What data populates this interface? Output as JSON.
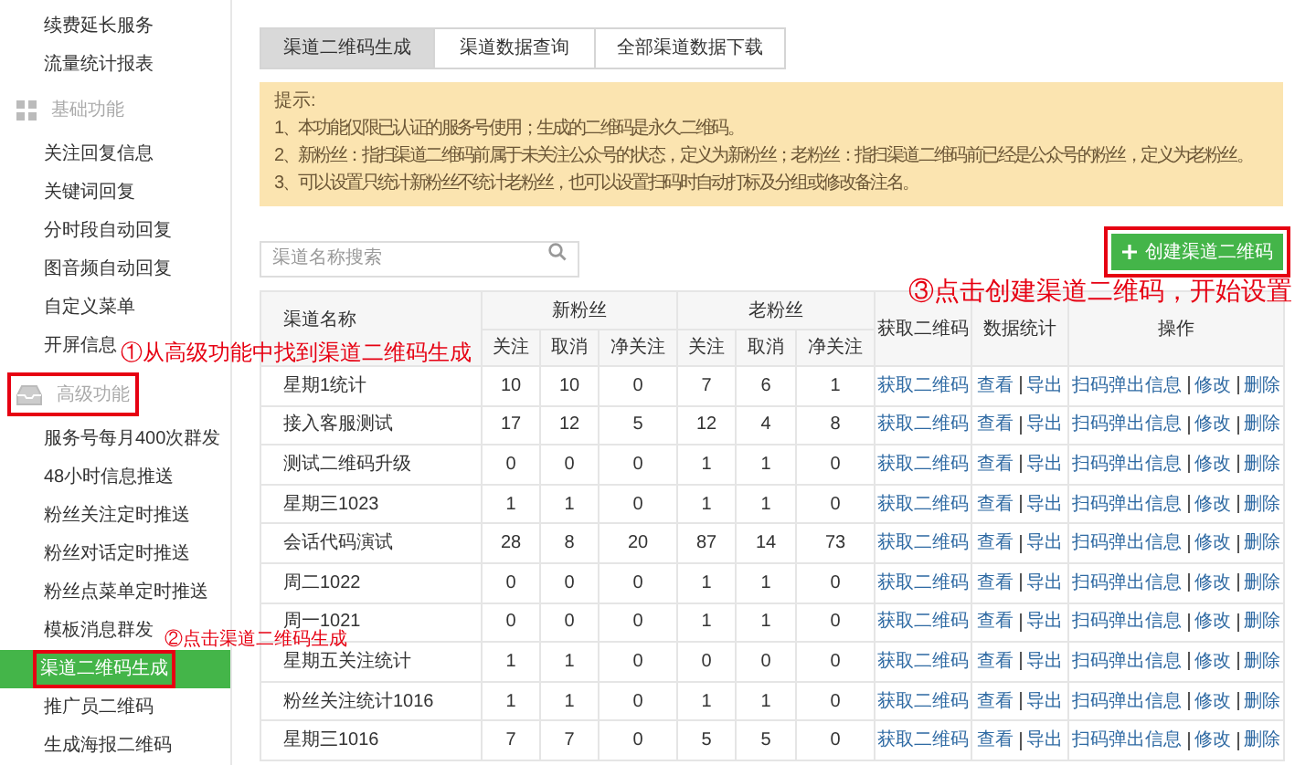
{
  "sidebar": {
    "items": [
      {
        "kind": "item",
        "label": "续费延长服务",
        "selected": false,
        "highlighted": false
      },
      {
        "kind": "item",
        "label": "流量统计报表",
        "selected": false,
        "highlighted": false
      },
      {
        "kind": "section",
        "label": "基础功能",
        "highlighted": false
      },
      {
        "kind": "item",
        "label": "关注回复信息",
        "selected": false,
        "highlighted": false
      },
      {
        "kind": "item",
        "label": "关键词回复",
        "selected": false,
        "highlighted": false
      },
      {
        "kind": "item",
        "label": "分时段自动回复",
        "selected": false,
        "highlighted": false
      },
      {
        "kind": "item",
        "label": "图音频自动回复",
        "selected": false,
        "highlighted": false
      },
      {
        "kind": "item",
        "label": "自定义菜单",
        "selected": false,
        "highlighted": false
      },
      {
        "kind": "item",
        "label": "开屏信息",
        "selected": false,
        "highlighted": false
      },
      {
        "kind": "section",
        "label": "高级功能",
        "highlighted": true
      },
      {
        "kind": "item",
        "label": "服务号每月400次群发",
        "selected": false,
        "highlighted": false
      },
      {
        "kind": "item",
        "label": "48小时信息推送",
        "selected": false,
        "highlighted": false
      },
      {
        "kind": "item",
        "label": "粉丝关注定时推送",
        "selected": false,
        "highlighted": false
      },
      {
        "kind": "item",
        "label": "粉丝对话定时推送",
        "selected": false,
        "highlighted": false
      },
      {
        "kind": "item",
        "label": "粉丝点菜单定时推送",
        "selected": false,
        "highlighted": false
      },
      {
        "kind": "item",
        "label": "模板消息群发",
        "selected": false,
        "highlighted": false
      },
      {
        "kind": "item",
        "label": "渠道二维码生成",
        "selected": true,
        "highlighted": true
      },
      {
        "kind": "item",
        "label": "推广员二维码",
        "selected": false,
        "highlighted": false
      },
      {
        "kind": "item",
        "label": "生成海报二维码",
        "selected": false,
        "highlighted": false
      }
    ]
  },
  "tabs": [
    {
      "label": "渠道二维码生成",
      "selected": true
    },
    {
      "label": "渠道数据查询",
      "selected": false
    },
    {
      "label": "全部渠道数据下载",
      "selected": false
    }
  ],
  "notice": {
    "title": "提示:",
    "lines": [
      "1、本功能仅限已认证的服务号使用；生成的二维码是永久二维码。",
      "2、新粉丝：指扫渠道二维码前属于未关注公众号的状态，定义为新粉丝；老粉丝：指扫渠道二维码前已经是公众号的粉丝，定义为老粉丝。",
      "3、可以设置只统计新粉丝不统计老粉丝，也可以设置扫码时自动打标及分组或修改备注名。"
    ]
  },
  "search": {
    "placeholder": "渠道名称搜索"
  },
  "create_button": {
    "label": "创建渠道二维码",
    "highlighted": true
  },
  "table": {
    "columns": [
      {
        "label": "渠道名称"
      },
      {
        "label": "新粉丝",
        "subcolumns": [
          "关注",
          "取消",
          "净关注"
        ]
      },
      {
        "label": "老粉丝",
        "subcolumns": [
          "关注",
          "取消",
          "净关注"
        ]
      },
      {
        "label": "获取二维码"
      },
      {
        "label": "数据统计"
      },
      {
        "label": "操作"
      }
    ],
    "rows": [
      {
        "name": "星期1统计",
        "new_fans": [
          "10",
          "10",
          "0"
        ],
        "old_fans": [
          "7",
          "6",
          "1"
        ],
        "qr_link": "获取二维码",
        "stats_links": [
          "查看",
          "导出"
        ],
        "actions": [
          "扫码弹出信息",
          "修改",
          "删除"
        ]
      },
      {
        "name": "接入客服测试",
        "new_fans": [
          "17",
          "12",
          "5"
        ],
        "old_fans": [
          "12",
          "4",
          "8"
        ],
        "qr_link": "获取二维码",
        "stats_links": [
          "查看",
          "导出"
        ],
        "actions": [
          "扫码弹出信息",
          "修改",
          "删除"
        ]
      },
      {
        "name": "测试二维码升级",
        "new_fans": [
          "0",
          "0",
          "0"
        ],
        "old_fans": [
          "1",
          "1",
          "0"
        ],
        "qr_link": "获取二维码",
        "stats_links": [
          "查看",
          "导出"
        ],
        "actions": [
          "扫码弹出信息",
          "修改",
          "删除"
        ]
      },
      {
        "name": "星期三1023",
        "new_fans": [
          "1",
          "1",
          "0"
        ],
        "old_fans": [
          "1",
          "1",
          "0"
        ],
        "qr_link": "获取二维码",
        "stats_links": [
          "查看",
          "导出"
        ],
        "actions": [
          "扫码弹出信息",
          "修改",
          "删除"
        ]
      },
      {
        "name": "会话代码演试",
        "new_fans": [
          "28",
          "8",
          "20"
        ],
        "old_fans": [
          "87",
          "14",
          "73"
        ],
        "qr_link": "获取二维码",
        "stats_links": [
          "查看",
          "导出"
        ],
        "actions": [
          "扫码弹出信息",
          "修改",
          "删除"
        ]
      },
      {
        "name": "周二1022",
        "new_fans": [
          "0",
          "0",
          "0"
        ],
        "old_fans": [
          "1",
          "1",
          "0"
        ],
        "qr_link": "获取二维码",
        "stats_links": [
          "查看",
          "导出"
        ],
        "actions": [
          "扫码弹出信息",
          "修改",
          "删除"
        ]
      },
      {
        "name": "周一1021",
        "new_fans": [
          "0",
          "0",
          "0"
        ],
        "old_fans": [
          "1",
          "1",
          "0"
        ],
        "qr_link": "获取二维码",
        "stats_links": [
          "查看",
          "导出"
        ],
        "actions": [
          "扫码弹出信息",
          "修改",
          "删除"
        ]
      },
      {
        "name": "星期五关注统计",
        "new_fans": [
          "1",
          "1",
          "0"
        ],
        "old_fans": [
          "0",
          "0",
          "0"
        ],
        "qr_link": "获取二维码",
        "stats_links": [
          "查看",
          "导出"
        ],
        "actions": [
          "扫码弹出信息",
          "修改",
          "删除"
        ]
      },
      {
        "name": "粉丝关注统计1016",
        "new_fans": [
          "1",
          "1",
          "0"
        ],
        "old_fans": [
          "1",
          "1",
          "0"
        ],
        "qr_link": "获取二维码",
        "stats_links": [
          "查看",
          "导出"
        ],
        "actions": [
          "扫码弹出信息",
          "修改",
          "删除"
        ]
      },
      {
        "name": "星期三1016",
        "new_fans": [
          "7",
          "7",
          "0"
        ],
        "old_fans": [
          "5",
          "5",
          "0"
        ],
        "qr_link": "获取二维码",
        "stats_links": [
          "查看",
          "导出"
        ],
        "actions": [
          "扫码弹出信息",
          "修改",
          "删除"
        ]
      }
    ]
  },
  "annotations": [
    {
      "text": "①从高级功能中找到渠道二维码生成"
    },
    {
      "text": "②点击渠道二维码生成"
    },
    {
      "text": "③点击创建渠道二维码，开始设置"
    }
  ]
}
